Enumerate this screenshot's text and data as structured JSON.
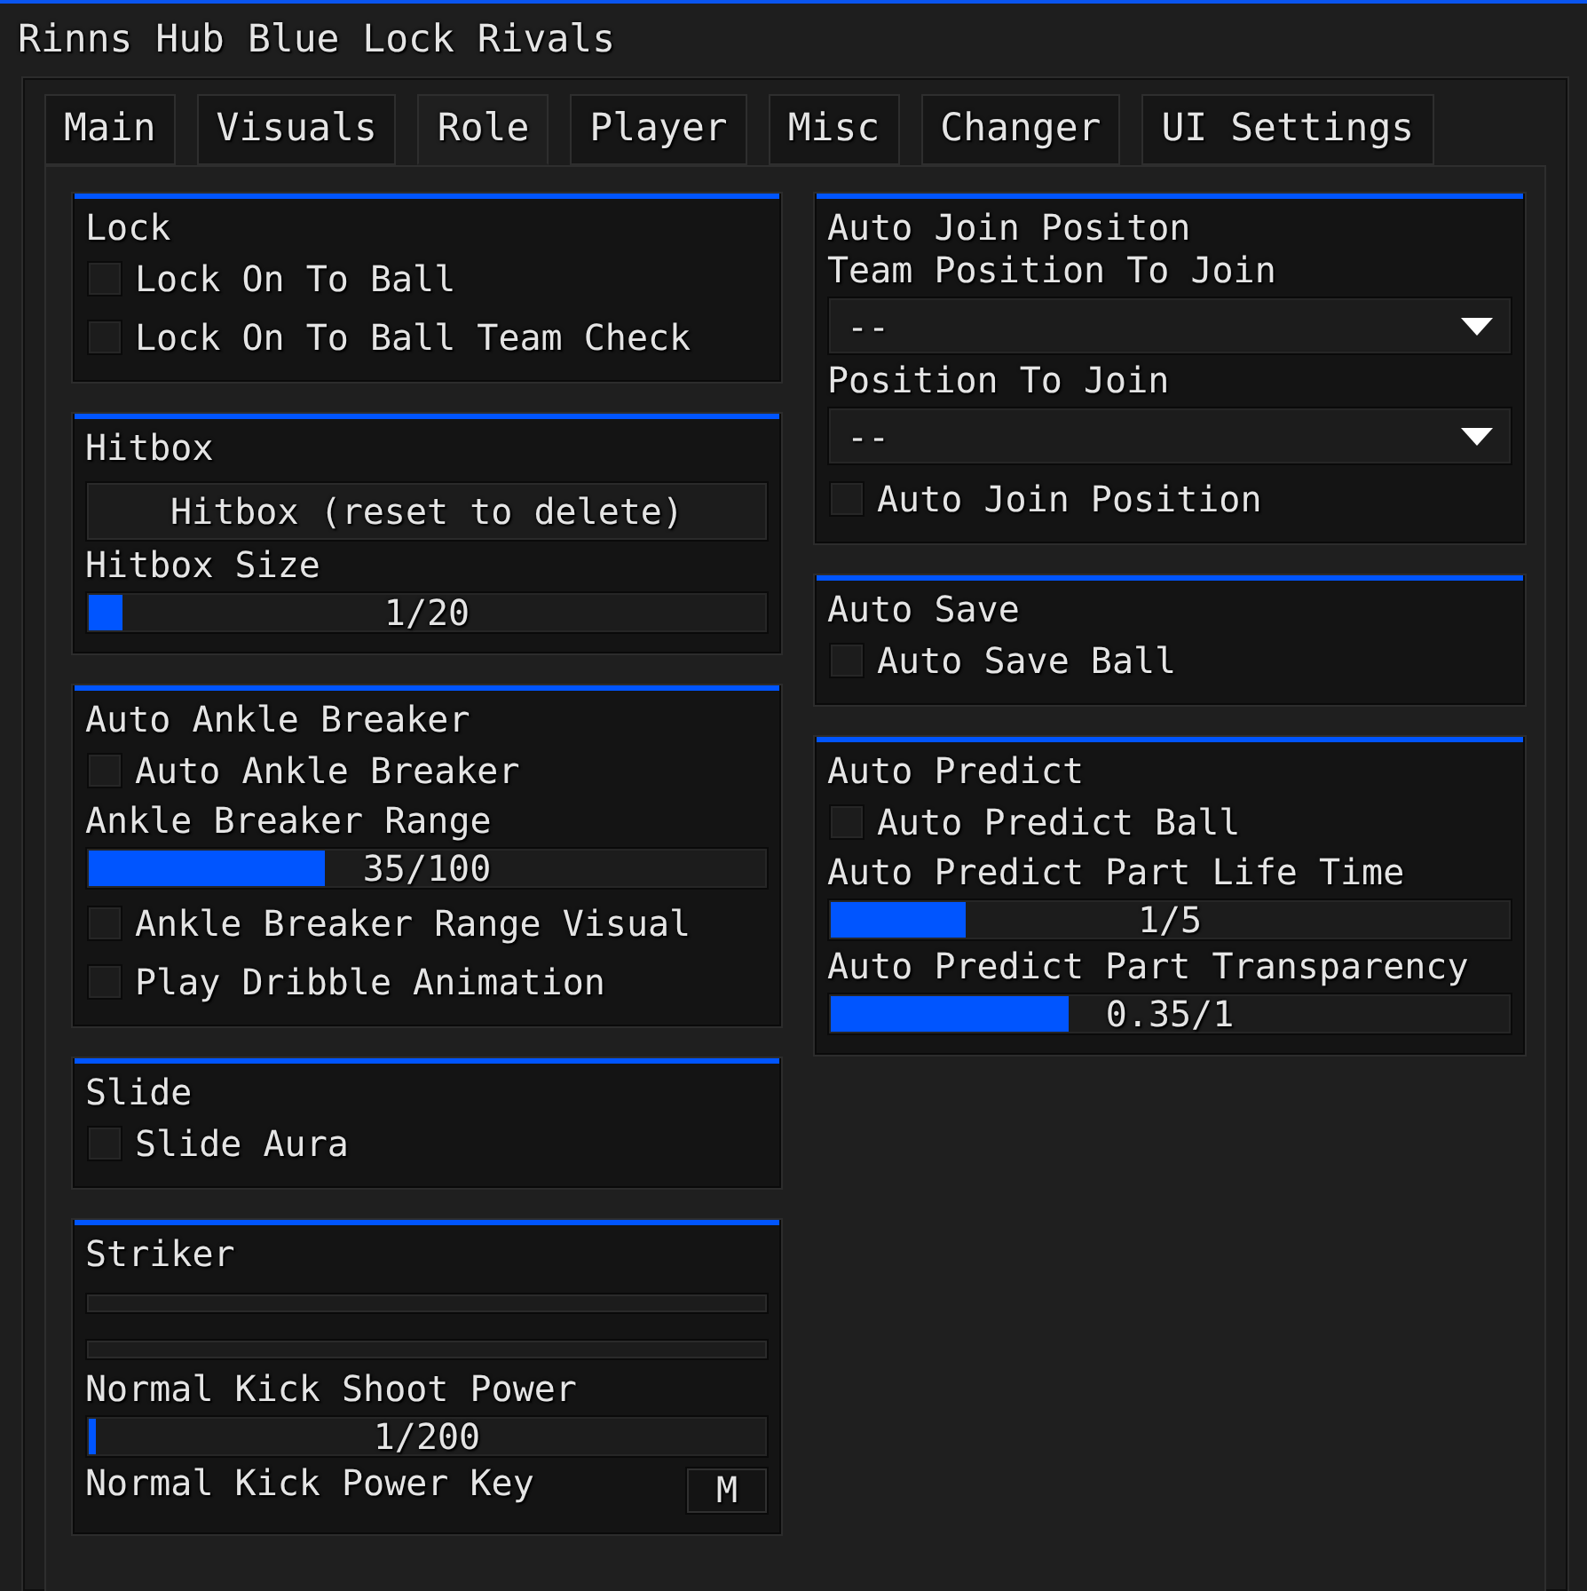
{
  "window": {
    "title": "Rinns Hub Blue Lock Rivals"
  },
  "tabs": [
    {
      "label": "Main",
      "selected": false
    },
    {
      "label": "Visuals",
      "selected": false
    },
    {
      "label": "Role",
      "selected": true
    },
    {
      "label": "Player",
      "selected": false
    },
    {
      "label": "Misc",
      "selected": false
    },
    {
      "label": "Changer",
      "selected": false
    },
    {
      "label": "UI Settings",
      "selected": false
    }
  ],
  "columns": [
    {
      "groups": [
        {
          "title": "Lock",
          "items": [
            {
              "kind": "toggle",
              "label": "Lock On To Ball",
              "checked": false
            },
            {
              "kind": "toggle",
              "label": "Lock On To Ball Team Check",
              "checked": false
            }
          ]
        },
        {
          "title": "Hitbox",
          "items": [
            {
              "kind": "button",
              "label": "Hitbox (reset to delete)"
            },
            {
              "kind": "label",
              "text": "Hitbox Size"
            },
            {
              "kind": "slider",
              "reading": "1/20",
              "level": 0.05
            }
          ]
        },
        {
          "title": "Auto Ankle Breaker",
          "items": [
            {
              "kind": "toggle",
              "label": "Auto Ankle Breaker",
              "checked": false
            },
            {
              "kind": "label",
              "text": "Ankle Breaker Range"
            },
            {
              "kind": "slider",
              "reading": "35/100",
              "level": 0.35
            },
            {
              "kind": "toggle",
              "label": "Ankle Breaker Range Visual",
              "checked": false
            },
            {
              "kind": "toggle",
              "label": "Play Dribble Animation",
              "checked": false
            }
          ]
        },
        {
          "title": "Slide",
          "items": [
            {
              "kind": "toggle",
              "label": "Slide Aura",
              "checked": false
            }
          ]
        },
        {
          "title": "Striker",
          "items": [
            {
              "kind": "blank_bar"
            },
            {
              "kind": "blank_bar"
            },
            {
              "kind": "label",
              "text": "Normal Kick Shoot Power"
            },
            {
              "kind": "slider",
              "reading": "1/200",
              "level": 0.01
            },
            {
              "kind": "keybind",
              "label": "Normal Kick Power Key",
              "key": "M"
            }
          ]
        }
      ]
    },
    {
      "groups": [
        {
          "title": "Auto Join Positon",
          "items": [
            {
              "kind": "label",
              "text": "Team Position To Join"
            },
            {
              "kind": "dropdown",
              "value": "--"
            },
            {
              "kind": "label",
              "text": "Position To Join"
            },
            {
              "kind": "dropdown",
              "value": "--"
            },
            {
              "kind": "toggle",
              "label": "Auto Join Position",
              "checked": false
            }
          ]
        },
        {
          "title": "Auto Save",
          "items": [
            {
              "kind": "toggle",
              "label": "Auto Save Ball",
              "checked": false
            }
          ]
        },
        {
          "title": "Auto Predict",
          "items": [
            {
              "kind": "toggle",
              "label": "Auto Predict Ball",
              "checked": false
            },
            {
              "kind": "label",
              "text": "Auto Predict Part Life Time"
            },
            {
              "kind": "slider",
              "reading": "1/5",
              "level": 0.2
            },
            {
              "kind": "label",
              "text": "Auto Predict Part Transparency"
            },
            {
              "kind": "slider",
              "reading": "0.35/1",
              "level": 0.35
            }
          ]
        }
      ]
    }
  ]
}
